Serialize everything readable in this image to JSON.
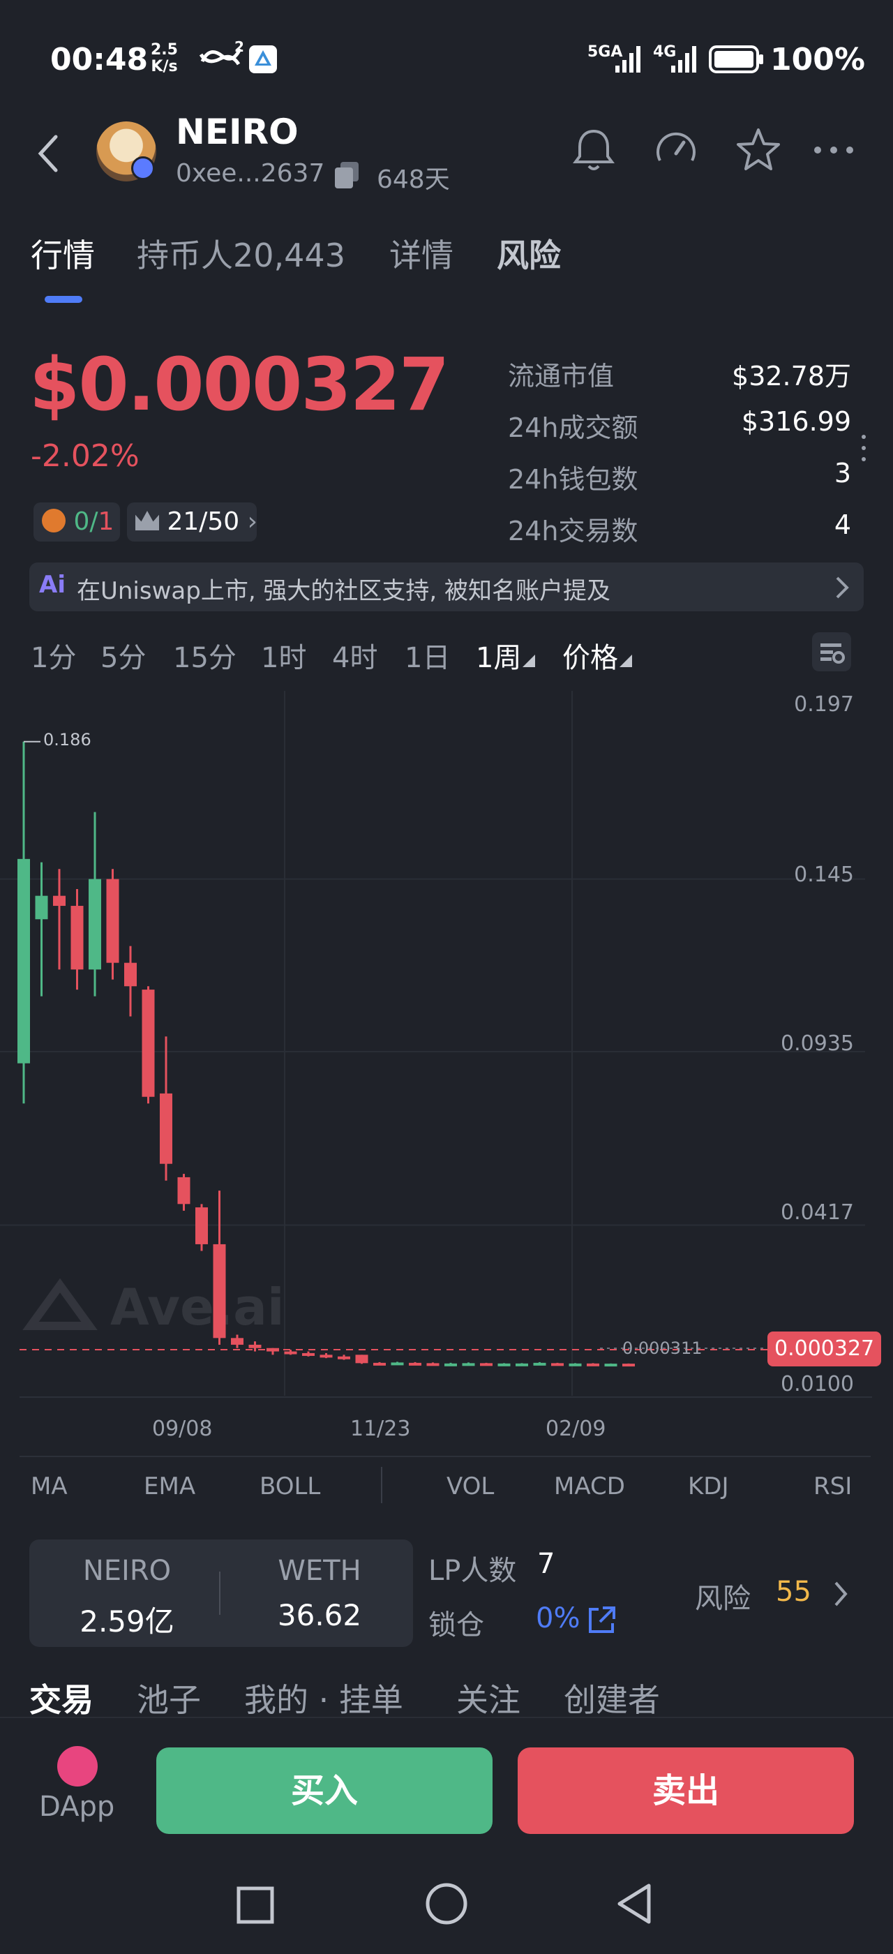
{
  "status": {
    "time": "00:48",
    "speed_top": "2.5",
    "speed_bottom": "K/s",
    "net1": "5GA",
    "net2": "4G",
    "battery": "100%"
  },
  "token": {
    "name": "NEIRO",
    "address": "0xee...2637",
    "age": "648天"
  },
  "tabs": [
    "行情",
    "持币人20,443",
    "详情",
    "风险"
  ],
  "price": {
    "value": "$0.000327",
    "change": "-2.02%"
  },
  "chips": {
    "a_left": "0/",
    "a_right": "1",
    "b": "21/50"
  },
  "stats": [
    {
      "label": "流通市值",
      "value": "$32.78万"
    },
    {
      "label": "24h成交额",
      "value": "$316.99"
    },
    {
      "label": "24h钱包数",
      "value": "3"
    },
    {
      "label": "24h交易数",
      "value": "4"
    }
  ],
  "ai_bar": {
    "badge": "Ai",
    "text": "在Uniswap上市, 强大的社区支持, 被知名账户提及"
  },
  "timeframes": [
    "1分",
    "5分",
    "15分",
    "1时",
    "4时",
    "1日",
    "1周",
    "价格"
  ],
  "chart_data": {
    "type": "candlestick",
    "y_ticks": [
      "0.197",
      "0.145",
      "0.0935",
      "0.0417",
      "0.0100"
    ],
    "x_ticks": [
      "09/08",
      "11/23",
      "02/09"
    ],
    "high_label": "0.186",
    "current_price_label": "0.000327",
    "ref_label": "0.000311",
    "watermark": "Ave.ai",
    "candles": [
      {
        "o": 0.09,
        "c": 0.151,
        "h": 0.186,
        "l": 0.078
      },
      {
        "o": 0.133,
        "c": 0.14,
        "h": 0.15,
        "l": 0.11
      },
      {
        "o": 0.14,
        "c": 0.137,
        "h": 0.148,
        "l": 0.118
      },
      {
        "o": 0.137,
        "c": 0.118,
        "h": 0.142,
        "l": 0.112
      },
      {
        "o": 0.118,
        "c": 0.145,
        "h": 0.165,
        "l": 0.11
      },
      {
        "o": 0.145,
        "c": 0.12,
        "h": 0.148,
        "l": 0.115
      },
      {
        "o": 0.12,
        "c": 0.113,
        "h": 0.125,
        "l": 0.104
      },
      {
        "o": 0.112,
        "c": 0.08,
        "h": 0.113,
        "l": 0.078
      },
      {
        "o": 0.081,
        "c": 0.06,
        "h": 0.098,
        "l": 0.055
      },
      {
        "o": 0.056,
        "c": 0.048,
        "h": 0.057,
        "l": 0.046
      },
      {
        "o": 0.047,
        "c": 0.036,
        "h": 0.048,
        "l": 0.034
      },
      {
        "o": 0.036,
        "c": 0.008,
        "h": 0.052,
        "l": 0.006
      },
      {
        "o": 0.008,
        "c": 0.006,
        "h": 0.009,
        "l": 0.005
      },
      {
        "o": 0.006,
        "c": 0.005,
        "h": 0.007,
        "l": 0.004
      },
      {
        "o": 0.005,
        "c": 0.004,
        "h": 0.005,
        "l": 0.003
      },
      {
        "o": 0.004,
        "c": 0.0035,
        "h": 0.0045,
        "l": 0.003
      },
      {
        "o": 0.0035,
        "c": 0.003,
        "h": 0.004,
        "l": 0.0025
      },
      {
        "o": 0.003,
        "c": 0.0025,
        "h": 0.0035,
        "l": 0.002
      },
      {
        "o": 0.0025,
        "c": 0.002,
        "h": 0.003,
        "l": 0.0015
      },
      {
        "o": 0.003,
        "c": 0.0005,
        "h": 0.003,
        "l": 0.0003
      },
      {
        "o": 0.0006,
        "c": 0.0005,
        "h": 0.0008,
        "l": 0.0003
      },
      {
        "o": 0.0005,
        "c": 0.0007,
        "h": 0.0009,
        "l": 0.0003
      },
      {
        "o": 0.0006,
        "c": 0.0005,
        "h": 0.0008,
        "l": 0.0003
      },
      {
        "o": 0.0005,
        "c": 0.0004,
        "h": 0.0007,
        "l": 0.0003
      },
      {
        "o": 0.0004,
        "c": 0.0004,
        "h": 0.0006,
        "l": 0.0003
      },
      {
        "o": 0.0004,
        "c": 0.0005,
        "h": 0.0007,
        "l": 0.0003
      },
      {
        "o": 0.0005,
        "c": 0.0004,
        "h": 0.0006,
        "l": 0.0003
      },
      {
        "o": 0.0004,
        "c": 0.0004,
        "h": 0.0005,
        "l": 0.0003
      },
      {
        "o": 0.0004,
        "c": 0.0004,
        "h": 0.0005,
        "l": 0.0003
      },
      {
        "o": 0.0004,
        "c": 0.0006,
        "h": 0.0008,
        "l": 0.0003
      },
      {
        "o": 0.0005,
        "c": 0.0004,
        "h": 0.0006,
        "l": 0.0003
      },
      {
        "o": 0.0004,
        "c": 0.0004,
        "h": 0.0005,
        "l": 0.0003
      },
      {
        "o": 0.0004,
        "c": 0.00035,
        "h": 0.0005,
        "l": 0.0003
      },
      {
        "o": 0.00035,
        "c": 0.00035,
        "h": 0.0004,
        "l": 0.0003
      },
      {
        "o": 0.00035,
        "c": 0.00033,
        "h": 0.0004,
        "l": 0.0003
      }
    ]
  },
  "indicators": [
    "MA",
    "EMA",
    "BOLL",
    "VOL",
    "MACD",
    "KDJ",
    "RSI"
  ],
  "pool": {
    "token_a": "NEIRO",
    "amount_a": "2.59亿",
    "token_b": "WETH",
    "amount_b": "36.62"
  },
  "lp": {
    "count_label": "LP人数",
    "count_value": "7",
    "lock_label": "锁仓",
    "lock_value": "0%",
    "risk_label": "风险",
    "risk_value": "55"
  },
  "bottom_tabs": [
    "交易",
    "池子",
    "我的 · 挂单",
    "关注",
    "创建者"
  ],
  "actions": {
    "dapp": "DApp",
    "buy": "买入",
    "sell": "卖出"
  },
  "colors": {
    "up": "#4fb887",
    "down": "#e5525e",
    "accent": "#4f7cf7",
    "risk": "#f2b84b"
  }
}
